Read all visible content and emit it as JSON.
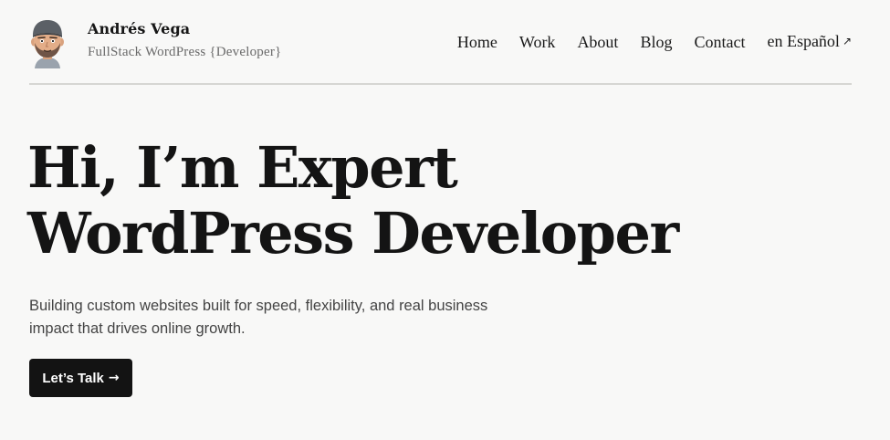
{
  "header": {
    "name": "Andrés Vega",
    "tagline": "FullStack WordPress {Developer}",
    "avatar_icon": "cartoon-face-avatar"
  },
  "nav": {
    "items": [
      {
        "label": "Home"
      },
      {
        "label": "Work"
      },
      {
        "label": "About"
      },
      {
        "label": "Blog"
      },
      {
        "label": "Contact"
      },
      {
        "label": "en Español",
        "external_icon": "↗"
      }
    ]
  },
  "hero": {
    "title_line1": "Hi, I’m Expert",
    "title_line2": "WordPress Developer",
    "subtitle": "Building custom websites built for speed, flexibility, and real business impact that drives online growth.",
    "cta_label": "Let’s Talk",
    "cta_arrow": "→"
  },
  "colors": {
    "background": "#f8f8f7",
    "text": "#161616",
    "muted": "#6a6a6a",
    "divider": "#d6d6d3",
    "button": "#131313"
  }
}
